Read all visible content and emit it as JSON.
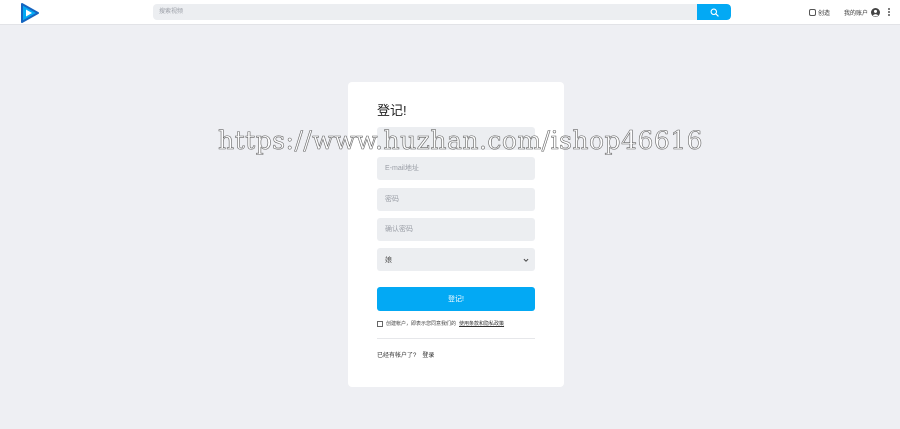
{
  "header": {
    "search_placeholder": "搜索视频",
    "upload_label": "创造",
    "account_label": "我的账户",
    "icons": {
      "logo": "play-logo-icon",
      "search": "search-icon",
      "upload": "upload-icon",
      "account": "user-circle-icon",
      "more": "more-vertical-icon"
    },
    "accent_color": "#03a9f4"
  },
  "form": {
    "title": "登记!",
    "username_placeholder": "",
    "email_placeholder": "E-mail地址",
    "password_placeholder": "密码",
    "confirm_password_placeholder": "确认密码",
    "gender_selected": "娘",
    "submit_label": "登记!",
    "terms_prefix": "创建帐户，即表示您同意我们的",
    "terms_link": "使用条款和隐私政策",
    "have_account_text": "已经有帐户了?",
    "login_link": "登录"
  },
  "watermark": "https://www.huzhan.com/ishop46616"
}
